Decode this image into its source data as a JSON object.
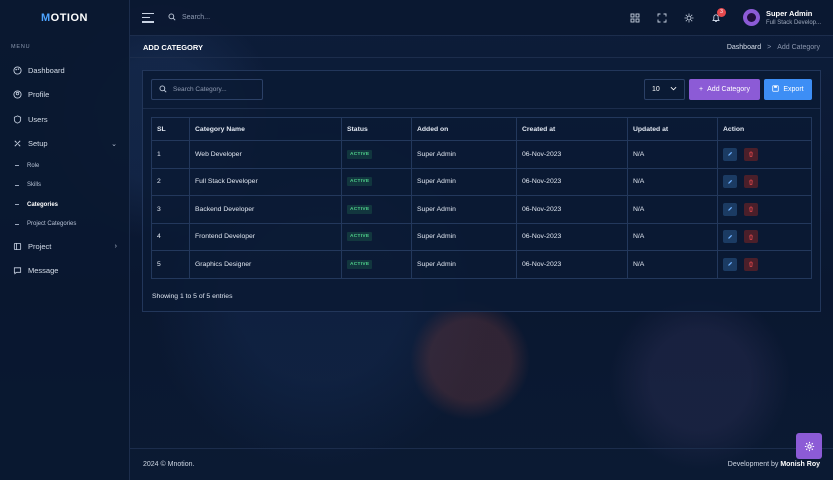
{
  "brand": {
    "logo_first": "M",
    "logo_rest": "OTION"
  },
  "sidebar": {
    "menu_label": "MENU",
    "items": [
      {
        "label": "Dashboard",
        "icon": "palette-icon"
      },
      {
        "label": "Profile",
        "icon": "user-circle-icon"
      },
      {
        "label": "Users",
        "icon": "shield-icon"
      },
      {
        "label": "Setup",
        "icon": "tools-icon"
      },
      {
        "label": "Project",
        "icon": "book-icon"
      },
      {
        "label": "Message",
        "icon": "chat-icon"
      }
    ],
    "sub_items": [
      "Role",
      "Skills",
      "Categories",
      "Project Categories"
    ]
  },
  "header": {
    "search_placeholder": "Search...",
    "notifications": "3",
    "user_name": "Super Admin",
    "user_role": "Full Stack Develop..."
  },
  "page": {
    "title": "ADD CATEGORY",
    "breadcrumb_root": "Dashboard",
    "breadcrumb_sep": ">",
    "breadcrumb_current": "Add Category"
  },
  "toolbar": {
    "search_placeholder": "Search Category...",
    "page_size": "10",
    "add_label": "Add Category",
    "export_label": "Export"
  },
  "table": {
    "headers": [
      "SL",
      "Category Name",
      "Status",
      "Added on",
      "Created at",
      "Updated at",
      "Action"
    ],
    "rows": [
      {
        "sl": "1",
        "name": "Web Developer",
        "status": "ACTIVE",
        "added": "Super Admin",
        "created": "06-Nov-2023",
        "updated": "N/A"
      },
      {
        "sl": "2",
        "name": "Full Stack Developer",
        "status": "ACTIVE",
        "added": "Super Admin",
        "created": "06-Nov-2023",
        "updated": "N/A"
      },
      {
        "sl": "3",
        "name": "Backend Developer",
        "status": "ACTIVE",
        "added": "Super Admin",
        "created": "06-Nov-2023",
        "updated": "N/A"
      },
      {
        "sl": "4",
        "name": "Frontend Developer",
        "status": "ACTIVE",
        "added": "Super Admin",
        "created": "06-Nov-2023",
        "updated": "N/A"
      },
      {
        "sl": "5",
        "name": "Graphics Designer",
        "status": "ACTIVE",
        "added": "Super Admin",
        "created": "06-Nov-2023",
        "updated": "N/A"
      }
    ],
    "showing": "Showing 1 to 5 of 5 entries"
  },
  "footer": {
    "copyright": "2024 © Mnotion.",
    "dev_prefix": "Development by",
    "author": "Monish Roy"
  },
  "colors": {
    "accent": "#8c5bd6",
    "primary": "#3d8ef5",
    "status_active": "#4fd18b",
    "delete": "#e5484d"
  }
}
